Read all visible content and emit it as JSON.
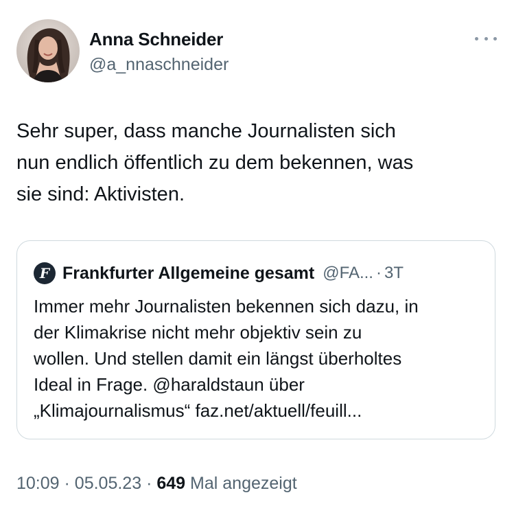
{
  "author": {
    "name": "Anna Schneider",
    "handle": "@a_nnaschneider",
    "avatar_icon": "profile-photo"
  },
  "tweet": {
    "text": "Sehr super, dass manche Journalisten sich\nnun endlich öffentlich zu dem bekennen, was\nsie sind: Aktivisten."
  },
  "quote": {
    "logo_glyph": "F",
    "name": "Frankfurter Allgemeine gesamt",
    "handle": "@FA...",
    "separator": "·",
    "time": "3T",
    "text": "Immer mehr Journalisten bekennen sich dazu, in\nder Klimakrise nicht mehr objektiv sein zu\nwollen. Und stellen damit ein längst überholtes\nIdeal in Frage. @haraldstaun über\n„Klimajournalismus“ faz.net/aktuell/feuill..."
  },
  "meta": {
    "time": "10:09",
    "sep1": "·",
    "date": "05.05.23",
    "sep2": "·",
    "views": "649",
    "views_label": "Mal angezeigt"
  },
  "colors": {
    "text": "#0f1419",
    "secondary": "#536471",
    "border": "#cfd9de"
  },
  "icons": {
    "more": "more-dots-icon",
    "quote_logo": "faz-logo-icon"
  }
}
